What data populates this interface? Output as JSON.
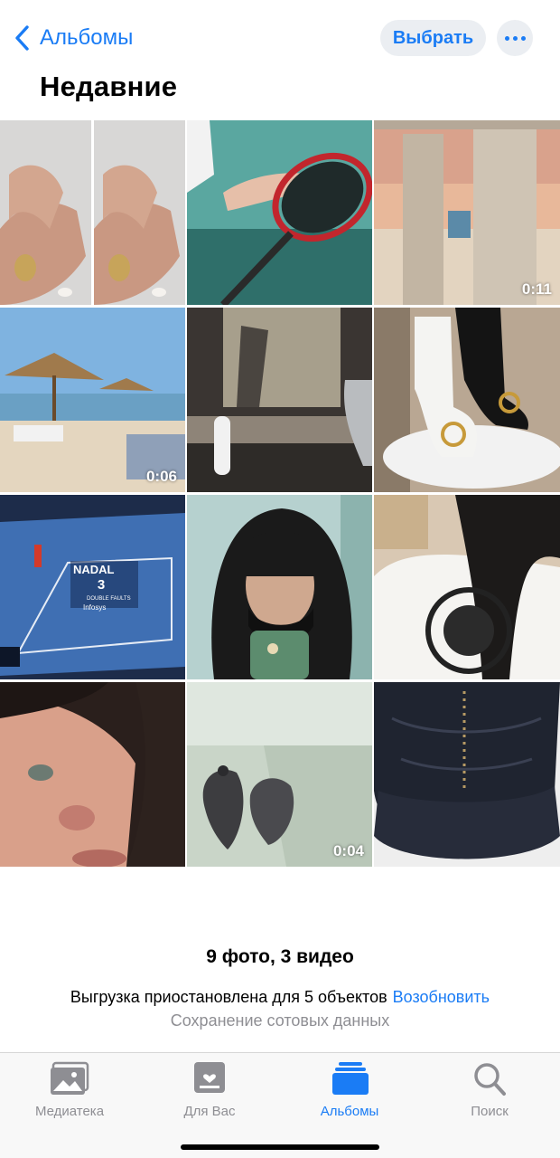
{
  "nav": {
    "back_label": "Альбомы",
    "select_label": "Выбрать"
  },
  "title": "Недавние",
  "grid": {
    "items": [
      {
        "kind": "photo",
        "duration": ""
      },
      {
        "kind": "photo",
        "duration": ""
      },
      {
        "kind": "video",
        "duration": "0:11"
      },
      {
        "kind": "video",
        "duration": "0:06"
      },
      {
        "kind": "photo",
        "duration": ""
      },
      {
        "kind": "photo",
        "duration": ""
      },
      {
        "kind": "photo",
        "duration": "",
        "overlay_text": {
          "name": "NADAL",
          "count": "3",
          "label": "DOUBLE FAULTS",
          "sponsor": "Infosys"
        }
      },
      {
        "kind": "photo",
        "duration": ""
      },
      {
        "kind": "photo",
        "duration": ""
      },
      {
        "kind": "photo",
        "duration": ""
      },
      {
        "kind": "video",
        "duration": "0:04"
      },
      {
        "kind": "photo",
        "duration": ""
      }
    ]
  },
  "summary": "9 фото, 3 видео",
  "upload": {
    "status": "Выгрузка приостановлена для 5 объектов",
    "resume_label": "Возобновить",
    "note": "Сохранение сотовых данных"
  },
  "tabbar": {
    "tabs": [
      {
        "label": "Медиатека",
        "icon": "photo-library-icon",
        "active": false
      },
      {
        "label": "Для Вас",
        "icon": "for-you-icon",
        "active": false
      },
      {
        "label": "Альбомы",
        "icon": "albums-icon",
        "active": true
      },
      {
        "label": "Поиск",
        "icon": "search-icon",
        "active": false
      }
    ]
  },
  "colors": {
    "accent": "#1a7cf5",
    "button_bg": "#ebeef2",
    "secondary_text": "#8e8e93",
    "tabbar_bg": "#f8f8f8"
  }
}
